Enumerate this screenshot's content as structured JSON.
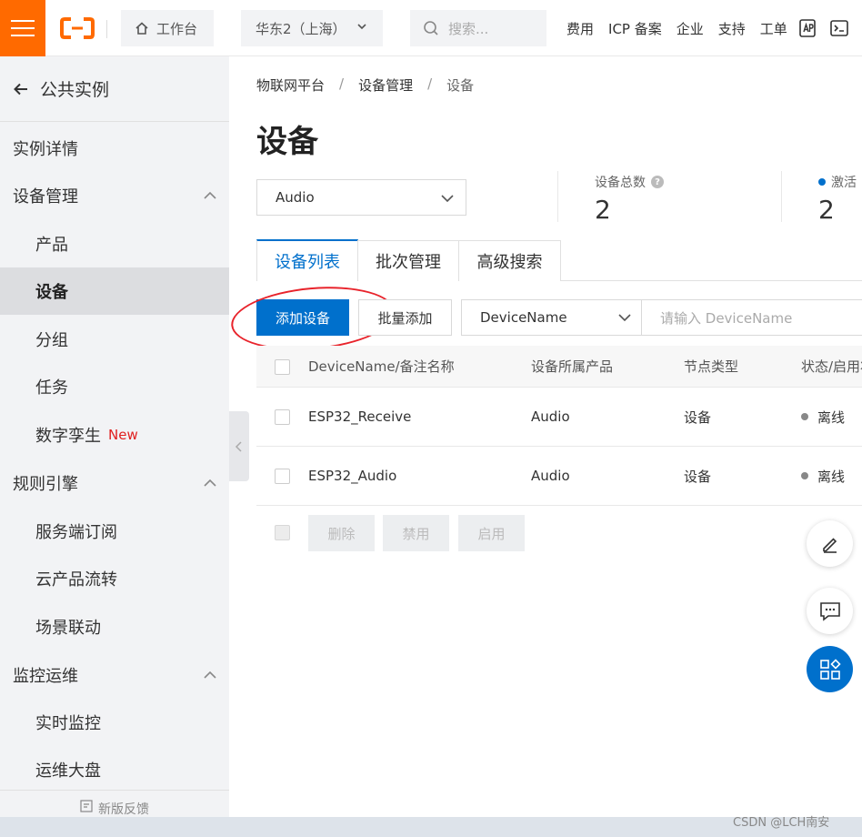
{
  "topbar": {
    "workbench": "工作台",
    "region": "华东2（上海）",
    "search_placeholder": "搜索...",
    "links": [
      "费用",
      "ICP 备案",
      "企业",
      "支持",
      "工单"
    ],
    "brand_color": "#ff6a00"
  },
  "sidebar": {
    "back_label": "公共实例",
    "items": [
      {
        "label": "实例详情"
      },
      {
        "label": "设备管理"
      },
      {
        "label": "产品"
      },
      {
        "label": "设备"
      },
      {
        "label": "分组"
      },
      {
        "label": "任务"
      },
      {
        "label": "数字孪生",
        "badge": "New"
      },
      {
        "label": "规则引擎"
      },
      {
        "label": "服务端订阅"
      },
      {
        "label": "云产品流转"
      },
      {
        "label": "场景联动"
      },
      {
        "label": "监控运维"
      },
      {
        "label": "实时监控"
      },
      {
        "label": "运维大盘"
      }
    ],
    "footer": "新版反馈"
  },
  "breadcrumb": [
    "物联网平台",
    "设备管理",
    "设备"
  ],
  "page_title": "设备",
  "product_select": "Audio",
  "stats": {
    "total_label": "设备总数",
    "total_value": "2",
    "active_label": "激活",
    "active_value": "2"
  },
  "tabs": [
    "设备列表",
    "批次管理",
    "高级搜索"
  ],
  "toolbar": {
    "add_device": "添加设备",
    "batch_add": "批量添加",
    "field_select": "DeviceName",
    "search_placeholder": "请输入 DeviceName"
  },
  "table": {
    "columns": [
      "DeviceName/备注名称",
      "设备所属产品",
      "节点类型",
      "状态/启用状态"
    ],
    "rows": [
      {
        "name": "ESP32_Receive",
        "product": "Audio",
        "node": "设备",
        "status": "离线"
      },
      {
        "name": "ESP32_Audio",
        "product": "Audio",
        "node": "设备",
        "status": "离线"
      }
    ],
    "bulk_actions": [
      "删除",
      "禁用",
      "启用"
    ]
  },
  "watermark": "CSDN @LCH南安",
  "colors": {
    "primary": "#0070cc",
    "annotation": "#e8232b"
  }
}
